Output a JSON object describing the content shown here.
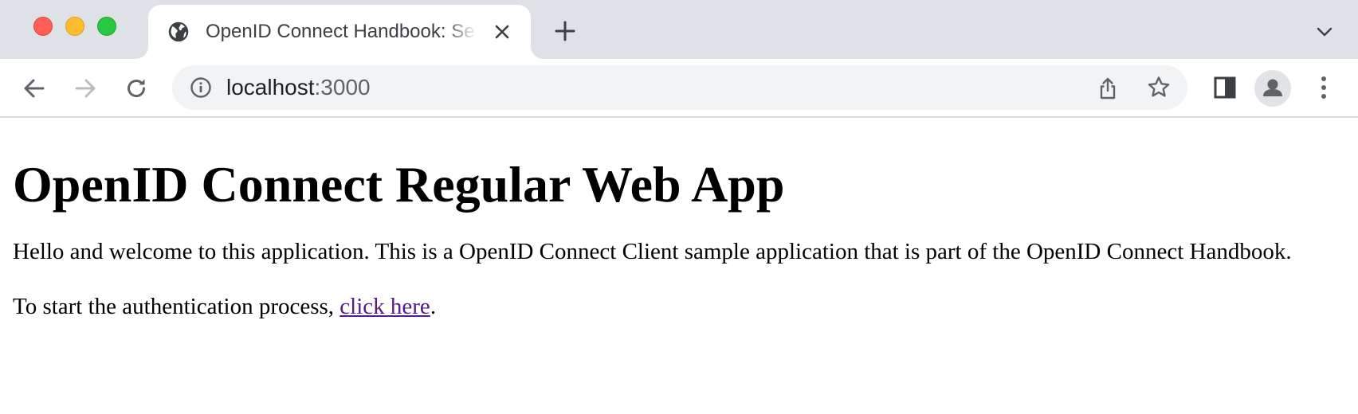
{
  "browser": {
    "tab": {
      "title": "OpenID Connect Handbook: Se"
    },
    "address_bar": {
      "host": "localhost",
      "port": ":3000"
    },
    "icons": {
      "window_close": "traffic-light-red",
      "window_minimize": "traffic-light-yellow",
      "window_maximize": "traffic-light-green",
      "favicon": "globe-icon",
      "tab_close": "close-icon",
      "new_tab": "plus-icon",
      "tab_search": "chevron-down-icon",
      "back": "arrow-left-icon",
      "forward": "arrow-right-icon",
      "reload": "reload-icon",
      "site_info": "info-icon",
      "share": "share-icon",
      "bookmark": "star-icon",
      "side_panel": "side-panel-icon",
      "profile": "person-icon",
      "menu": "kebab-menu-icon"
    }
  },
  "page": {
    "heading": "OpenID Connect Regular Web App",
    "intro": "Hello and welcome to this application. This is a OpenID Connect Client sample application that is part of the OpenID Connect Handbook.",
    "start_prefix": "To start the authentication process, ",
    "start_link": "click here",
    "start_suffix": "."
  },
  "colors": {
    "tabstrip_bg": "#dee1e6",
    "omnibox_bg": "#f1f3f4",
    "visited_link": "#551a8b"
  }
}
